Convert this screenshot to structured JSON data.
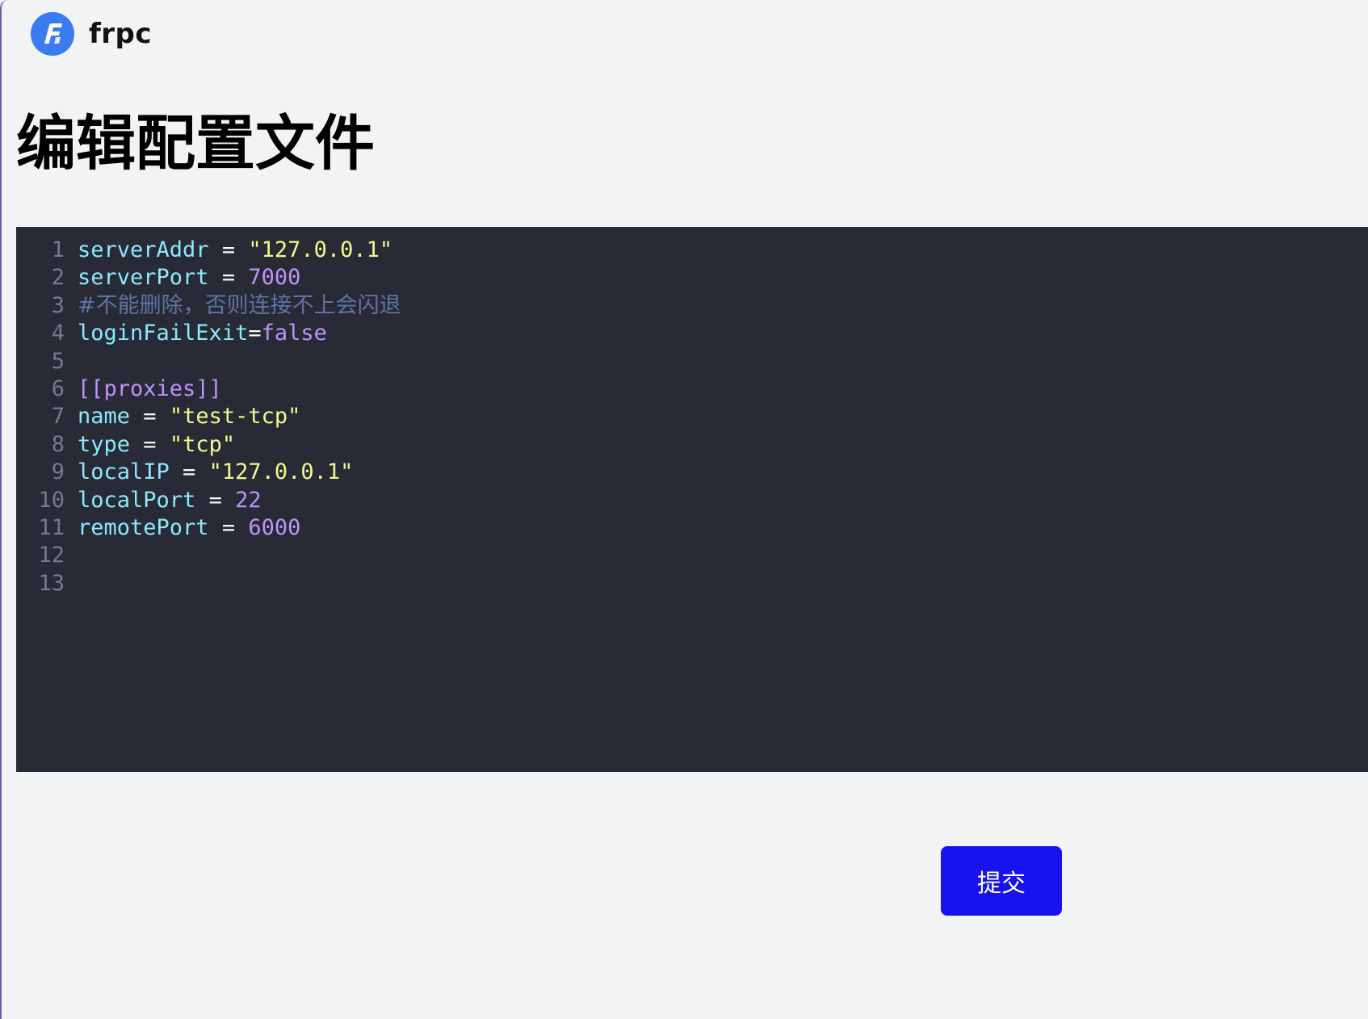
{
  "app": {
    "name": "frpc",
    "logo_icon": "frp-logo-icon",
    "accent": "#3b7bf0"
  },
  "page": {
    "title": "编辑配置文件"
  },
  "editor": {
    "theme": "dark",
    "background": "#282a36",
    "lines": [
      {
        "num": "1",
        "tokens": [
          {
            "t": "serverAddr",
            "c": "k"
          },
          {
            "t": " = ",
            "c": "op"
          },
          {
            "t": "\"127.0.0.1\"",
            "c": "s"
          }
        ]
      },
      {
        "num": "2",
        "tokens": [
          {
            "t": "serverPort",
            "c": "k"
          },
          {
            "t": " = ",
            "c": "op"
          },
          {
            "t": "7000",
            "c": "n"
          }
        ]
      },
      {
        "num": "3",
        "tokens": [
          {
            "t": "#不能删除，否则连接不上会闪退",
            "c": "c"
          }
        ]
      },
      {
        "num": "4",
        "tokens": [
          {
            "t": "loginFailExit",
            "c": "k"
          },
          {
            "t": "=",
            "c": "op"
          },
          {
            "t": "false",
            "c": "n"
          }
        ]
      },
      {
        "num": "5",
        "tokens": []
      },
      {
        "num": "6",
        "tokens": [
          {
            "t": "[[proxies]]",
            "c": "b"
          }
        ]
      },
      {
        "num": "7",
        "tokens": [
          {
            "t": "name",
            "c": "k"
          },
          {
            "t": " = ",
            "c": "op"
          },
          {
            "t": "\"test-tcp\"",
            "c": "s"
          }
        ]
      },
      {
        "num": "8",
        "tokens": [
          {
            "t": "type",
            "c": "k"
          },
          {
            "t": " = ",
            "c": "op"
          },
          {
            "t": "\"tcp\"",
            "c": "s"
          }
        ]
      },
      {
        "num": "9",
        "tokens": [
          {
            "t": "localIP",
            "c": "k"
          },
          {
            "t": " = ",
            "c": "op"
          },
          {
            "t": "\"127.0.0.1\"",
            "c": "s"
          }
        ]
      },
      {
        "num": "10",
        "tokens": [
          {
            "t": "localPort",
            "c": "k"
          },
          {
            "t": " = ",
            "c": "op"
          },
          {
            "t": "22",
            "c": "n"
          }
        ]
      },
      {
        "num": "11",
        "tokens": [
          {
            "t": "remotePort",
            "c": "k"
          },
          {
            "t": " = ",
            "c": "op"
          },
          {
            "t": "6000",
            "c": "n"
          }
        ]
      },
      {
        "num": "12",
        "tokens": []
      },
      {
        "num": "13",
        "tokens": []
      }
    ]
  },
  "actions": {
    "submit_label": "提交",
    "submit_color": "#1a12ee"
  }
}
